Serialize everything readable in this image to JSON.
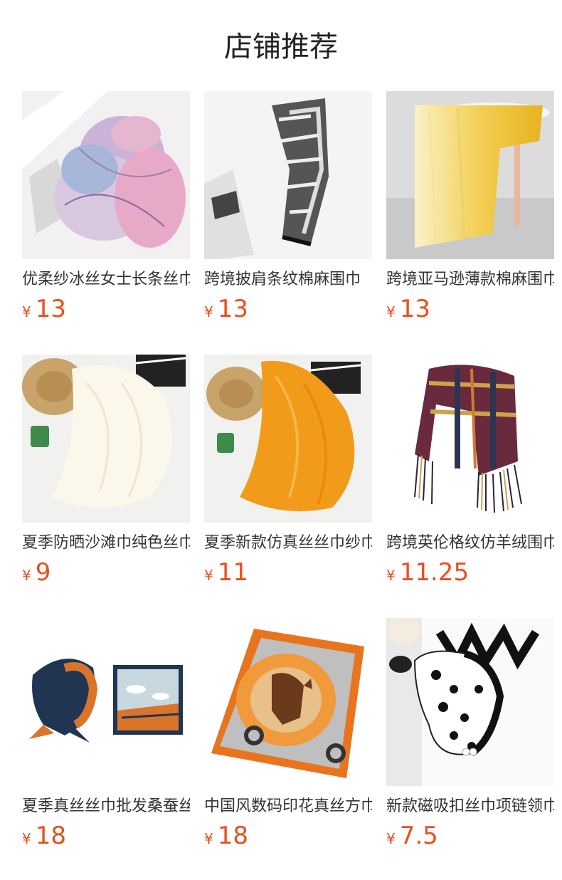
{
  "header": {
    "title": "店铺推荐"
  },
  "products": [
    {
      "name": "优柔纱冰丝女士长条丝巾",
      "currency": "¥",
      "price": "13",
      "image": "pastel-floral-scarf"
    },
    {
      "name": "跨境披肩条纹棉麻围巾",
      "currency": "¥",
      "price": "13",
      "image": "black-white-striped-scarf"
    },
    {
      "name": "跨境亚马逊薄款棉麻围巾",
      "currency": "¥",
      "price": "13",
      "image": "yellow-gradient-scarf"
    },
    {
      "name": "夏季防晒沙滩巾纯色丝巾",
      "currency": "¥",
      "price": "9",
      "image": "ivory-chiffon-scarf"
    },
    {
      "name": "夏季新款仿真丝丝巾纱巾",
      "currency": "¥",
      "price": "11",
      "image": "orange-chiffon-scarf"
    },
    {
      "name": "跨境英伦格纹仿羊绒围巾",
      "currency": "¥",
      "price": "11.25",
      "image": "plaid-tassel-scarf"
    },
    {
      "name": "夏季真丝丝巾批发桑蚕丝",
      "currency": "¥",
      "price": "18",
      "image": "crane-print-silk-scarf"
    },
    {
      "name": "中国风数码印花真丝方巾",
      "currency": "¥",
      "price": "18",
      "image": "horse-print-square-scarf"
    },
    {
      "name": "新款磁吸扣丝巾项链领巾",
      "currency": "¥",
      "price": "7.5",
      "image": "polka-dot-scarf-necklace"
    }
  ],
  "colors": {
    "price": "#e8501e",
    "text": "#333333",
    "title": "#222222"
  }
}
